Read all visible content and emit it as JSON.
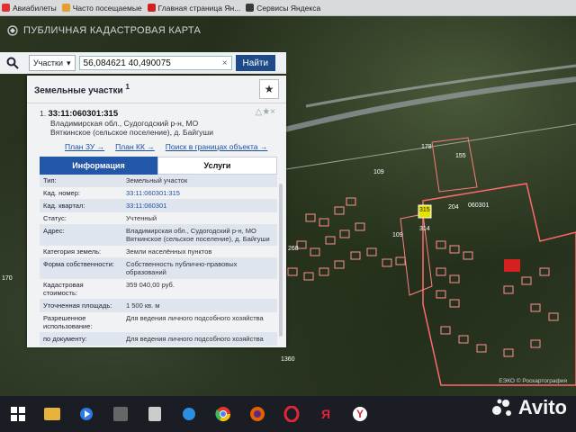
{
  "bookmarks": [
    {
      "label": "Авиабилеты",
      "color": "#e03030"
    },
    {
      "label": "Часто посещаемые",
      "color": "#e2a12e"
    },
    {
      "label": "Главная страница Ян...",
      "color": "#d02020"
    },
    {
      "label": "Сервисы Яндекса",
      "color": "#3a3a3a"
    }
  ],
  "header": {
    "title": "ПУБЛИЧНАЯ КАДАСТРОВАЯ КАРТА"
  },
  "search": {
    "type_label": "Участки",
    "value": "56,084621 40,490075",
    "button": "Найти"
  },
  "panel": {
    "title": "Земельные участки",
    "count": "1",
    "item_num": "1.",
    "cad_number": "33:11:060301:315",
    "address_line1": "Владимирская обл., Судогодский р-н, МО",
    "address_line2": "Вяткинское (сельское поселение), д. Байгуши",
    "links": [
      "План ЗУ →",
      "План КК →",
      "Поиск в границах объекта →"
    ],
    "tabs": [
      "Информация",
      "Услуги"
    ],
    "rows": [
      {
        "k": "Тип:",
        "v": "Земельный участок"
      },
      {
        "k": "Кад. номер:",
        "v": "33:11:060301:315",
        "link": true
      },
      {
        "k": "Кад. квартал:",
        "v": "33:11:060301",
        "link": true
      },
      {
        "k": "Статус:",
        "v": "Учтенный"
      },
      {
        "k": "Адрес:",
        "v": "Владимирская обл., Судогодский р-н, МО Вяткинское (сельское поселение), д. Байгуши"
      },
      {
        "k": "Категория земель:",
        "v": "Земли населённых пунктов"
      },
      {
        "k": "Форма собственности:",
        "v": "Собственность публично-правовых образований"
      },
      {
        "k": "Кадастровая стоимость:",
        "v": "359 040,00 руб."
      },
      {
        "k": "Уточненная площадь:",
        "v": "1 500 кв. м"
      },
      {
        "k": "Разрешенное использование:",
        "v": "Для ведения личного подсобного хозяйства"
      },
      {
        "k": "по документу:",
        "v": "Для ведения личного подсобного хозяйства"
      }
    ]
  },
  "map_labels": [
    "109",
    "178",
    "155",
    "204",
    "060301",
    "314",
    "315",
    "109",
    "1360",
    "170",
    "268"
  ],
  "copyright": "ЕЭКО © Роскартография",
  "watermark": "Avito",
  "taskbar_icons": [
    "windows-start-icon",
    "file-explorer-icon",
    "media-player-icon",
    "app-icon",
    "calculator-icon",
    "edge-icon",
    "chrome-icon",
    "firefox-icon",
    "opera-icon",
    "yandex-ya-icon",
    "yandex-browser-icon"
  ]
}
